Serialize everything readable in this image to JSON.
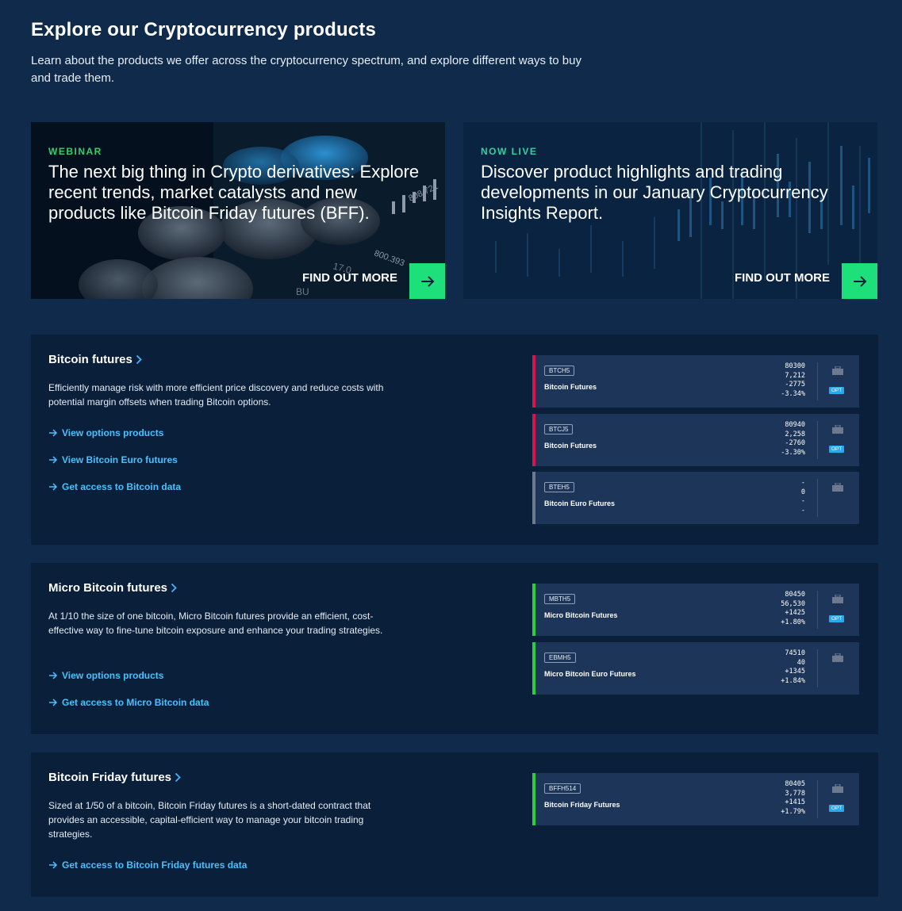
{
  "header": {
    "title": "Explore our Cryptocurrency products",
    "subtitle": "Learn about the products we offer across the cryptocurrency spectrum, and explore different ways to buy and trade them."
  },
  "promos": [
    {
      "kicker": "WEBINAR",
      "title": "The next big thing in Crypto derivatives: Explore recent trends, market catalysts and new products like Bitcoin Friday futures (BFF).",
      "cta": "FIND OUT MORE",
      "image_text": [
        "808.721",
        "800.393",
        "17.0",
        "BU"
      ]
    },
    {
      "kicker": "NOW LIVE",
      "title": "Discover product highlights and trading developments in our January Cryptocurrency Insights Report.",
      "cta": "FIND OUT MORE"
    }
  ],
  "sections": [
    {
      "title": "Bitcoin futures",
      "description": "Efficiently manage risk with more efficient price discovery and reduce costs with potential margin offsets when trading Bitcoin options.",
      "links": [
        "View options products",
        "View Bitcoin Euro futures",
        "Get access to Bitcoin data"
      ],
      "tickers": [
        {
          "code": "BTCH5",
          "name": "Bitcoin Futures",
          "last": "80300",
          "volume": "7,212",
          "change": "-2775",
          "pct": "-3.34%",
          "opt": "OPT",
          "trend_color": "#d6164a"
        },
        {
          "code": "BTCJ5",
          "name": "Bitcoin Futures",
          "last": "80940",
          "volume": "2,258",
          "change": "-2760",
          "pct": "-3.30%",
          "opt": "OPT",
          "trend_color": "#d6164a"
        },
        {
          "code": "BTEH5",
          "name": "Bitcoin Euro Futures",
          "last": "-",
          "volume": "0",
          "change": "-",
          "pct": "-",
          "opt": "",
          "trend_color": "#6b7a8f"
        }
      ]
    },
    {
      "title": "Micro Bitcoin futures",
      "description": "At 1/10 the size of one bitcoin, Micro Bitcoin futures provide an efficient, cost-effective way to fine-tune bitcoin exposure and enhance your trading strategies.",
      "links": [
        "View options products",
        "Get access to Micro Bitcoin data"
      ],
      "tickers": [
        {
          "code": "MBTH5",
          "name": "Micro Bitcoin Futures",
          "last": "80450",
          "volume": "56,530",
          "change": "+1425",
          "pct": "+1.80%",
          "opt": "OPT",
          "trend_color": "#2ecc40"
        },
        {
          "code": "EBMH5",
          "name": "Micro Bitcoin Euro Futures",
          "last": "74510",
          "volume": "40",
          "change": "+1345",
          "pct": "+1.84%",
          "opt": "",
          "trend_color": "#2ecc40"
        }
      ]
    },
    {
      "title": "Bitcoin Friday futures",
      "description": "Sized at 1/50 of a bitcoin, Bitcoin Friday futures is a short-dated contract that provides an accessible, capital-efficient way to manage your bitcoin trading strategies.",
      "links": [
        "Get access to Bitcoin Friday futures data"
      ],
      "tickers": [
        {
          "code": "BFFH514",
          "name": "Bitcoin Friday Futures",
          "last": "80405",
          "volume": "3,778",
          "change": "+1415",
          "pct": "+1.79%",
          "opt": "OPT",
          "trend_color": "#2ecc40"
        }
      ]
    }
  ],
  "colors": {
    "background": "#0f2a4a",
    "panel": "#0a1f3a",
    "ticker_card": "#1c3558",
    "link": "#4ac0ff",
    "cta_button": "#1ee07a"
  }
}
